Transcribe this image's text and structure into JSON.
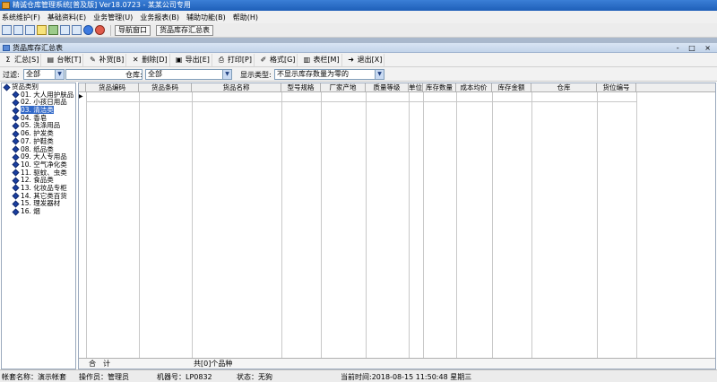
{
  "app": {
    "title": "精诚仓库管理系统[普及版] Ver18.0723 - 某某公司专用"
  },
  "menu": [
    "系统维护(F)",
    "基础资料(E)",
    "业务管理(U)",
    "业务报表(B)",
    "辅助功能(B)",
    "帮助(H)"
  ],
  "toolbar": {
    "nav_button": "导航窗口",
    "summary_button": "货品库存汇总表"
  },
  "child_window": {
    "title": "货品库存汇总表",
    "controls": "- □ ×"
  },
  "actions": [
    {
      "icon": "sum-icon",
      "glyph": "Σ",
      "label": "汇总[S]"
    },
    {
      "icon": "ledger-icon",
      "glyph": "▤",
      "label": "台帐[T]"
    },
    {
      "icon": "restock-icon",
      "glyph": "✎",
      "label": "补货[B]"
    },
    {
      "icon": "delete-icon",
      "glyph": "✕",
      "label": "删除[D]"
    },
    {
      "icon": "export-icon",
      "glyph": "▣",
      "label": "导出[E]"
    },
    {
      "icon": "print-icon",
      "glyph": "⎙",
      "label": "打印[P]"
    },
    {
      "icon": "format-icon",
      "glyph": "✐",
      "label": "格式[G]"
    },
    {
      "icon": "columns-icon",
      "glyph": "▥",
      "label": "表栏[M]"
    },
    {
      "icon": "exit-icon",
      "glyph": "➜",
      "label": "退出[X]"
    }
  ],
  "filter": {
    "filter_label": "过滤:",
    "filter_value": "全部",
    "warehouse_label": "仓库:",
    "warehouse_value": "全部",
    "display_label": "显示类型:",
    "display_value": "不显示库存数量为零的"
  },
  "tree": {
    "root": "货品类别",
    "items": [
      "01. 大人用护肤品",
      "02. 小孩日用品",
      "03. 清洁类",
      "04. 香皂",
      "05. 洗涤用品",
      "06. 护发类",
      "07. 护鞋类",
      "08. 纸品类",
      "09. 大人专用品",
      "10. 空气净化类",
      "11. 驱蚊、虫类",
      "12. 食品类",
      "13. 化妆品专柜",
      "14. 其它类百货",
      "15. 理发器材",
      "16. 烟"
    ],
    "selected_index": 2
  },
  "grid": {
    "columns": [
      "货品编码",
      "货品条码",
      "货品名称",
      "型号规格",
      "厂家产地",
      "质量等级",
      "单位",
      "库存数量",
      "成本均价",
      "库存金额",
      "仓库",
      "货位编号"
    ],
    "row_indicator": "▶",
    "footer_total_label": "合　计",
    "footer_count": "共[0]个品种"
  },
  "status": {
    "account": "帐套名称：演示帐套",
    "operator": "操作员：管理员",
    "machine": "机器号：LP0832",
    "state": "状态：无狗",
    "time": "当前时间:2018-08-15 11:50:48 星期三"
  }
}
